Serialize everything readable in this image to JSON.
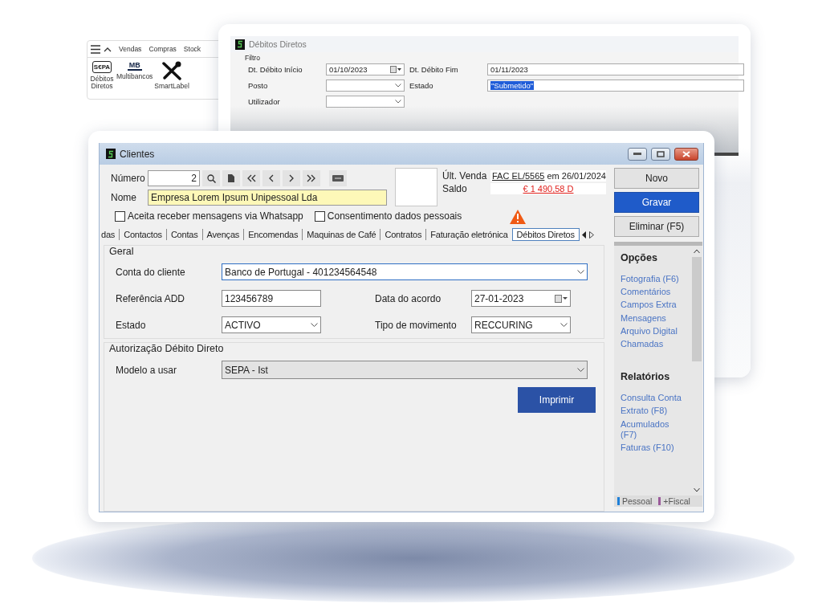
{
  "ribbon": {
    "tabs": [
      {
        "label": "Vendas"
      },
      {
        "label": "Compras"
      },
      {
        "label": "Stock"
      }
    ],
    "items": [
      {
        "label": "Débitos Diretos",
        "kind": "sepa",
        "badge": "S€PA"
      },
      {
        "label": "Multibancos",
        "kind": "mb",
        "badge": "MB"
      },
      {
        "label": "SmartLabel",
        "kind": "tools"
      }
    ]
  },
  "back_window": {
    "title": "Débitos Diretos",
    "group": "Filtro",
    "left_fields": [
      {
        "label": "Dt. Débito Início",
        "kind": "date",
        "value": "01/10/2023"
      },
      {
        "label": "Posto",
        "kind": "combo"
      },
      {
        "label": "Utilizador",
        "kind": "combo"
      }
    ],
    "right_fields": [
      {
        "label": "Dt. Débito Fim",
        "value": "01/11/2023",
        "selected": false
      },
      {
        "label": "Estado",
        "value": "\"Submetido\"",
        "selected": true
      }
    ]
  },
  "window": {
    "title": "Clientes",
    "numero": {
      "label": "Número",
      "value": "2"
    },
    "nome": {
      "label": "Nome",
      "value": "Empresa Lorem Ipsum Unipessoal Lda"
    },
    "ult_venda": {
      "label": "Últ. Venda",
      "link": "FAC EL/5565",
      "rest": "em 26/01/2024"
    },
    "saldo": {
      "label": "Saldo",
      "value": "€ 1 490,58 D"
    },
    "checkboxes": [
      {
        "label": "Aceita receber mensagens via Whatsapp",
        "checked": false
      },
      {
        "label": "Consentimento dados pessoais",
        "checked": false
      }
    ],
    "tabs": [
      {
        "label": "das",
        "selected": false
      },
      {
        "label": "Contactos",
        "selected": false
      },
      {
        "label": "Contas",
        "selected": false
      },
      {
        "label": "Avenças",
        "selected": false
      },
      {
        "label": "Encomendas",
        "selected": false
      },
      {
        "label": "Maquinas de Café",
        "selected": false
      },
      {
        "label": "Contratos",
        "selected": false
      },
      {
        "label": "Faturação eletrónica",
        "selected": false
      },
      {
        "label": "Débitos Diretos",
        "selected": true
      }
    ],
    "geral": {
      "title": "Geral",
      "conta": {
        "label": "Conta do cliente",
        "value": "Banco de Portugal - 401234564548",
        "kind": "combo"
      },
      "rows": [
        [
          {
            "label": "Referência ADD",
            "value": "123456789",
            "kind": "text"
          },
          {
            "label": "Data do acordo",
            "value": "27-01-2023",
            "kind": "date"
          }
        ],
        [
          {
            "label": "Estado",
            "value": "ACTIVO",
            "kind": "combo"
          },
          {
            "label": "Tipo de movimento",
            "value": "RECCURING",
            "kind": "combo"
          }
        ]
      ]
    },
    "autorizacao": {
      "title": "Autorização Débito Direto",
      "modelo": {
        "label": "Modelo a usar",
        "value": "SEPA - Ist"
      },
      "button": "Imprimir"
    },
    "actions": [
      {
        "label": "Novo",
        "kind": "default"
      },
      {
        "label": "Gravar",
        "kind": "primary"
      },
      {
        "label": "Eliminar (F5)",
        "kind": "default"
      }
    ],
    "sections": [
      {
        "title": "Opções",
        "links": [
          "Fotografia (F6)",
          "Comentários",
          "Campos Extra",
          "Mensagens",
          "Arquivo Digital",
          "Chamadas"
        ]
      },
      {
        "title": "Relatórios",
        "links": [
          "Consulta Conta",
          "Extrato (F8)",
          "Acumulados (F7)",
          "Faturas (F10)"
        ]
      }
    ],
    "legend": [
      {
        "label": "Pessoal",
        "color": "#1e7fd8"
      },
      {
        "label": "+Fiscal",
        "color": "#9a5a9a"
      }
    ]
  }
}
